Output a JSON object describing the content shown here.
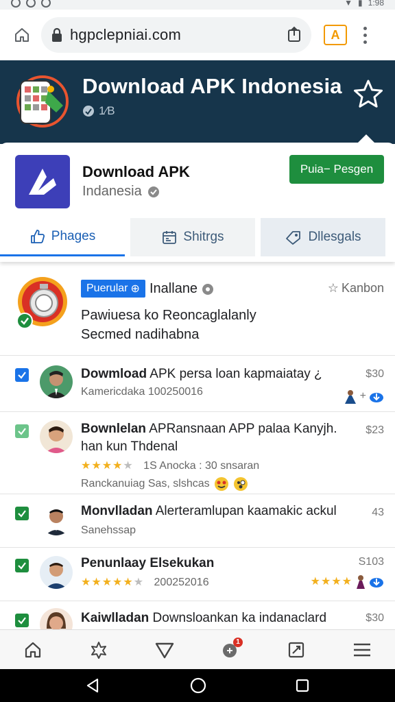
{
  "status_bar": {
    "time": "1:98"
  },
  "browser": {
    "url": "hgpclepniai.com",
    "tab_icon_label": "A"
  },
  "banner": {
    "title": "Download APK Indonesia",
    "subtitle": "1⁄B"
  },
  "app": {
    "name": "Download APK",
    "developer": "Indanesia",
    "install_label": "Puia− Pesgen",
    "tabs": [
      {
        "label": "Phages",
        "icon": "thumbs-up-icon",
        "active": true
      },
      {
        "label": "Shitrgs",
        "icon": "calendar-icon",
        "active": false
      },
      {
        "label": "Dllesgals",
        "icon": "tag-icon",
        "active": false
      }
    ]
  },
  "featured": {
    "badge": "Puerular",
    "name": "Inallane",
    "side_label": "Kanbon",
    "description": "Pawiuesa ko  Reoncaglalanly Secmed nadihabna"
  },
  "list": [
    {
      "title_bold": "Dowmload",
      "title_rest": " APK persa loan kapmaiatay ¿",
      "sub": "Kamericdaka  100250016",
      "price": "$30"
    },
    {
      "title_bold": "Bownlelan",
      "title_rest": " APRansnaan APP palaa Kanyjh. han kun Thdenal",
      "rating_text": "1S  Anocka : 30 snsaran",
      "sub": "Ranckanuiag  Sas, slshcas",
      "price": "$23"
    },
    {
      "title_bold": "Monvlladan",
      "title_rest": " Alerteramlupan kaamakic ackul",
      "sub": "Sanehssap",
      "price": "43"
    },
    {
      "title_bold": "Penunlaay Elsekukan",
      "title_rest": "",
      "rating_text": "200252016",
      "price": "S103"
    },
    {
      "title_bold": "Kaiwlladan",
      "title_rest": " Downsloankan ka indanaclard",
      "price": "$30"
    }
  ],
  "bottom_nav": {
    "notification_count": "1"
  },
  "colors": {
    "banner_bg": "#16354b",
    "install_green": "#1e8e3e",
    "accent_blue": "#1a73e8",
    "check_green": "#1e8e3e",
    "check_blue": "#1a73e8",
    "star": "#f2b01e"
  }
}
